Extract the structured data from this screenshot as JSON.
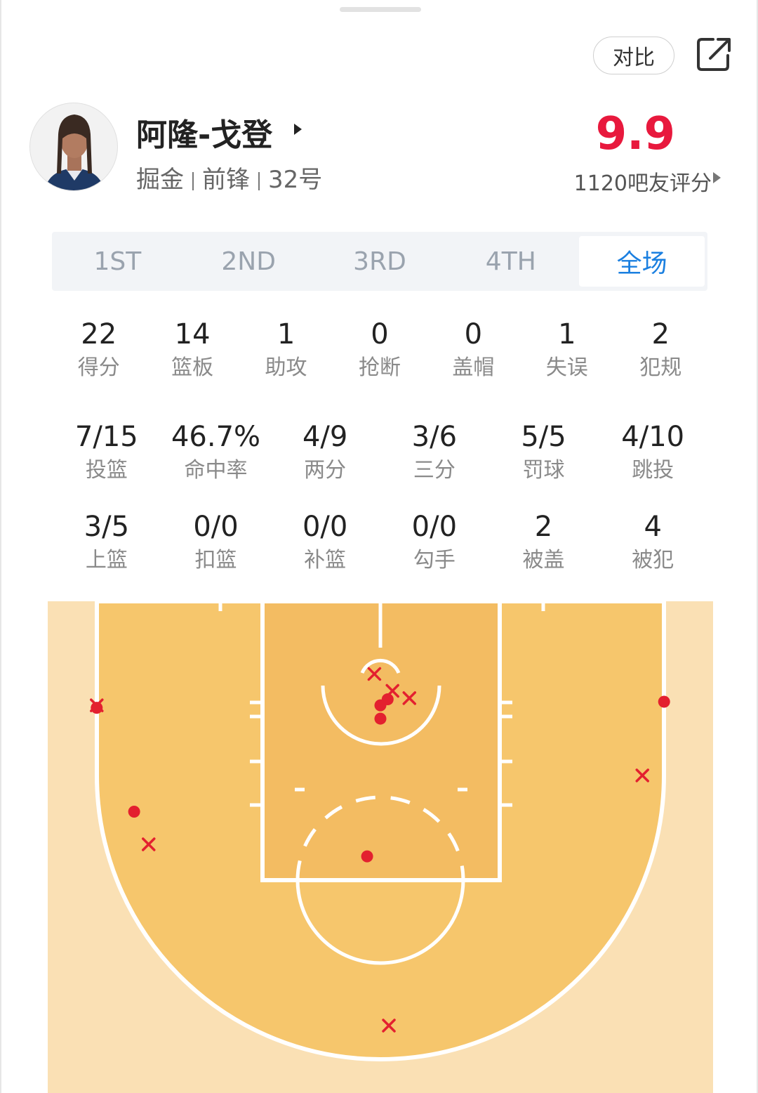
{
  "header": {
    "compare_label": "对比"
  },
  "player": {
    "name": "阿隆-戈登",
    "team": "掘金",
    "position": "前锋",
    "number": "32号"
  },
  "rating": {
    "score": "9.9",
    "caption": "1120吧友评分"
  },
  "periods": [
    {
      "label": "1ST",
      "active": false
    },
    {
      "label": "2ND",
      "active": false
    },
    {
      "label": "3RD",
      "active": false
    },
    {
      "label": "4TH",
      "active": false
    },
    {
      "label": "全场",
      "active": true
    }
  ],
  "stats_basic": [
    {
      "value": "22",
      "label": "得分"
    },
    {
      "value": "14",
      "label": "篮板"
    },
    {
      "value": "1",
      "label": "助攻"
    },
    {
      "value": "0",
      "label": "抢断"
    },
    {
      "value": "0",
      "label": "盖帽"
    },
    {
      "value": "1",
      "label": "失误"
    },
    {
      "value": "2",
      "label": "犯规"
    }
  ],
  "stats_shooting": [
    {
      "value": "7/15",
      "label": "投篮"
    },
    {
      "value": "46.7%",
      "label": "命中率"
    },
    {
      "value": "4/9",
      "label": "两分"
    },
    {
      "value": "3/6",
      "label": "三分"
    },
    {
      "value": "5/5",
      "label": "罚球"
    },
    {
      "value": "4/10",
      "label": "跳投"
    }
  ],
  "stats_detail": [
    {
      "value": "3/5",
      "label": "上篮"
    },
    {
      "value": "0/0",
      "label": "扣篮"
    },
    {
      "value": "0/0",
      "label": "补篮"
    },
    {
      "value": "0/0",
      "label": "勾手"
    },
    {
      "value": "2",
      "label": "被盖"
    },
    {
      "value": "4",
      "label": "被犯"
    }
  ],
  "shot_chart": {
    "colors": {
      "made": "#e3202f",
      "missed": "#e3202f",
      "paint": "#f6c66c",
      "outside": "#fae0b4",
      "lines": "#ffffff"
    },
    "shots": [
      {
        "result": "made",
        "x": -23.5,
        "y": 3.0
      },
      {
        "result": "missed",
        "x": -23.5,
        "y": 2.8
      },
      {
        "result": "made",
        "x": 23.5,
        "y": 2.5
      },
      {
        "result": "made",
        "x": 0.0,
        "y": 3.9
      },
      {
        "result": "made",
        "x": 0.0,
        "y": 2.8
      },
      {
        "result": "made",
        "x": 0.6,
        "y": 2.3
      },
      {
        "result": "missed",
        "x": 2.4,
        "y": 2.2
      },
      {
        "result": "missed",
        "x": 1.0,
        "y": 1.6
      },
      {
        "result": "missed",
        "x": -0.5,
        "y": 0.2
      },
      {
        "result": "made",
        "x": -1.1,
        "y": 15.3
      },
      {
        "result": "missed",
        "x": 21.7,
        "y": 8.6
      },
      {
        "result": "made",
        "x": -20.4,
        "y": 11.6
      },
      {
        "result": "missed",
        "x": -19.2,
        "y": 14.3
      },
      {
        "result": "missed",
        "x": 0.7,
        "y": 29.3
      }
    ]
  }
}
